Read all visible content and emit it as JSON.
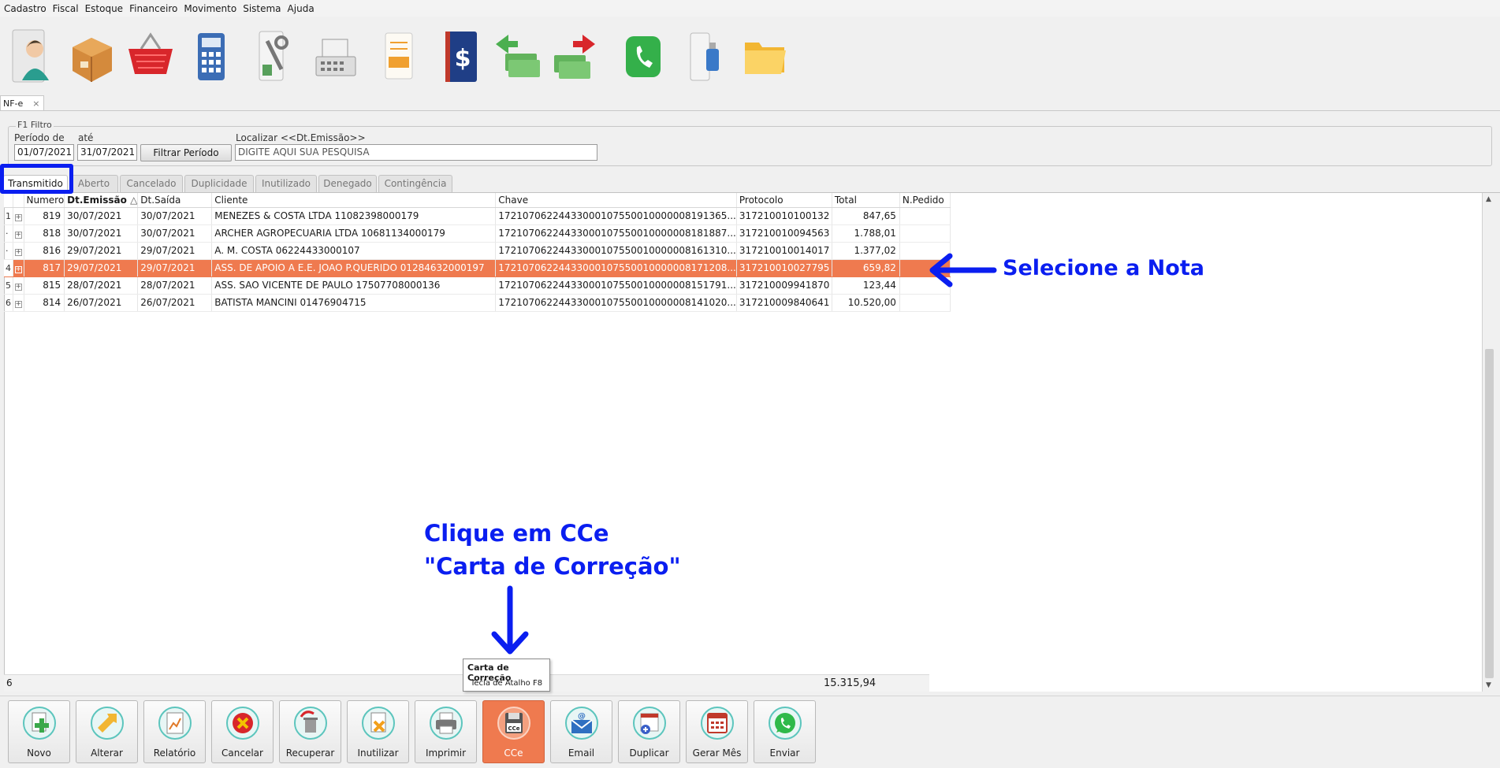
{
  "menu": [
    "Cadastro",
    "Fiscal",
    "Estoque",
    "Financeiro",
    "Movimento",
    "Sistema",
    "Ajuda"
  ],
  "iconbar": [
    {
      "icon": "client-icon"
    },
    {
      "icon": "product-box-icon"
    },
    {
      "icon": "shopping-basket-icon"
    },
    {
      "icon": "calculator-icon"
    },
    {
      "icon": "tools-icon"
    },
    {
      "icon": "cash-register-icon"
    },
    {
      "icon": "nfe-document-icon"
    },
    {
      "icon": "finance-book-icon"
    },
    {
      "icon": "money-receive-icon"
    },
    {
      "icon": "money-pay-icon"
    },
    {
      "icon": "phone-icon"
    },
    {
      "icon": "usb-backup-icon"
    },
    {
      "icon": "folder-icon"
    }
  ],
  "doc_tab": {
    "label": "NF-e",
    "close": "×"
  },
  "filter": {
    "legend": "F1 Filtro",
    "period_from_label": "Período de",
    "period_to_label": "até",
    "date_from": "01/07/2021",
    "date_to": "31/07/2021",
    "filter_button": "Filtrar Período",
    "search_label": "Localizar <<Dt.Emissão>>",
    "search_value": "DIGITE AQUI SUA PESQUISA"
  },
  "status_tabs": [
    "Transmitido",
    "Aberto",
    "Cancelado",
    "Duplicidade",
    "Inutilizado",
    "Denegado",
    "Contingência"
  ],
  "active_tab": "Transmitido",
  "grid": {
    "columns": [
      "Numero",
      "Dt.Emissão",
      "Dt.Saída",
      "Cliente",
      "Chave",
      "Protocolo",
      "Total",
      "N.Pedido"
    ],
    "sort_indicator": "△",
    "rows": [
      {
        "idx": "1",
        "numero": "819",
        "emissao": "30/07/2021",
        "saida": "30/07/2021",
        "cliente": "MENEZES & COSTA LTDA  11082398000179",
        "chave": "17210706224433000107550010000008191365...",
        "protocolo": "317210010100132",
        "total": "847,65",
        "pedido": ""
      },
      {
        "idx": "·",
        "numero": "818",
        "emissao": "30/07/2021",
        "saida": "30/07/2021",
        "cliente": "ARCHER AGROPECUARIA LTDA 10681134000179",
        "chave": "17210706224433000107550010000008181887...",
        "protocolo": "317210010094563",
        "total": "1.788,01",
        "pedido": ""
      },
      {
        "idx": "·",
        "numero": "816",
        "emissao": "29/07/2021",
        "saida": "29/07/2021",
        "cliente": "A. M. COSTA 06224433000107",
        "chave": "17210706224433000107550010000008161310...",
        "protocolo": "317210010014017",
        "total": "1.377,02",
        "pedido": ""
      },
      {
        "idx": "4",
        "numero": "817",
        "emissao": "29/07/2021",
        "saida": "29/07/2021",
        "cliente": "ASS. DE APOIO A E.E. JOAO P.QUERIDO 01284632000197",
        "chave": "17210706224433000107550010000008171208...",
        "protocolo": "317210010027795",
        "total": "659,82",
        "pedido": "",
        "selected": true
      },
      {
        "idx": "5",
        "numero": "815",
        "emissao": "28/07/2021",
        "saida": "28/07/2021",
        "cliente": "ASS. SAO VICENTE DE PAULO 17507708000136",
        "chave": "17210706224433000107550010000008151791...",
        "protocolo": "317210009941870",
        "total": "123,44",
        "pedido": ""
      },
      {
        "idx": "6",
        "numero": "814",
        "emissao": "26/07/2021",
        "saida": "26/07/2021",
        "cliente": "BATISTA MANCINI 01476904715",
        "chave": "17210706224433000107550010000008141020...",
        "protocolo": "317210009840641",
        "total": "10.520,00",
        "pedido": ""
      }
    ],
    "footer_count": "6",
    "footer_total": "15.315,94"
  },
  "toolbar": [
    {
      "label": "Novo",
      "icon": "new-document-icon"
    },
    {
      "label": "Alterar",
      "icon": "edit-arrows-icon"
    },
    {
      "label": "Relatório",
      "icon": "report-chart-icon"
    },
    {
      "label": "Cancelar",
      "icon": "cancel-x-icon"
    },
    {
      "label": "Recuperar",
      "icon": "recover-icon"
    },
    {
      "label": "Inutilizar",
      "icon": "void-document-icon"
    },
    {
      "label": "Imprimir",
      "icon": "printer-icon"
    },
    {
      "label": "CCe",
      "icon": "cce-disk-icon",
      "highlighted": true
    },
    {
      "label": "Email",
      "icon": "email-icon"
    },
    {
      "label": "Duplicar",
      "icon": "duplicate-calendar-icon"
    },
    {
      "label": "Gerar Mês",
      "icon": "calendar-icon"
    },
    {
      "label": "Enviar",
      "icon": "whatsapp-icon"
    }
  ],
  "tooltip": {
    "title": "Carta de Correção",
    "hint": "Tecla de Atalho F8"
  },
  "annotations": {
    "select_note": "Selecione a Nota",
    "click_line1": "Clique em CCe",
    "click_line2": "\"Carta de Correção\""
  },
  "colors": {
    "selection": "#ef7a4f",
    "annotation": "#0a1ef0",
    "cce_button": "#ef7a4f"
  }
}
